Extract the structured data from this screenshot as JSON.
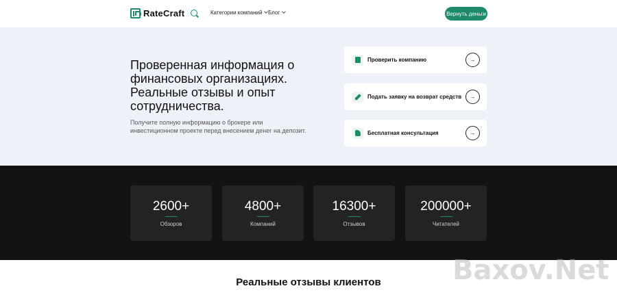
{
  "header": {
    "logo_text": "RateCraft",
    "nav": [
      {
        "label": "Категории компаний"
      },
      {
        "label": "Блог"
      }
    ],
    "cta_label": "Вернуть деньги"
  },
  "hero": {
    "title": "Проверенная информация о финансовых организациях. Реальные отзывы и опыт сотрудничества.",
    "subtitle": "Получите полную информацию о брокере или инвестиционном проекте перед внесением денег на депозит.",
    "actions": [
      {
        "label": "Проверить компанию",
        "icon": "shield-icon"
      },
      {
        "label": "Подать заявку на возврат средств",
        "icon": "pencil-icon"
      },
      {
        "label": "Бесплатная консультация",
        "icon": "chat-icon"
      }
    ]
  },
  "stats": [
    {
      "value": "2600+",
      "label": "Обзоров"
    },
    {
      "value": "4800+",
      "label": "Компаний"
    },
    {
      "value": "16300+",
      "label": "Отзывов"
    },
    {
      "value": "200000+",
      "label": "Читателей"
    }
  ],
  "reviews": {
    "title": "Реальные отзывы клиентов"
  },
  "watermark": "Baxov.Net",
  "colors": {
    "accent": "#1c8a6b",
    "hero_bg": "#eef2f8",
    "stats_bg": "#131313",
    "stat_card_bg": "#232323"
  }
}
